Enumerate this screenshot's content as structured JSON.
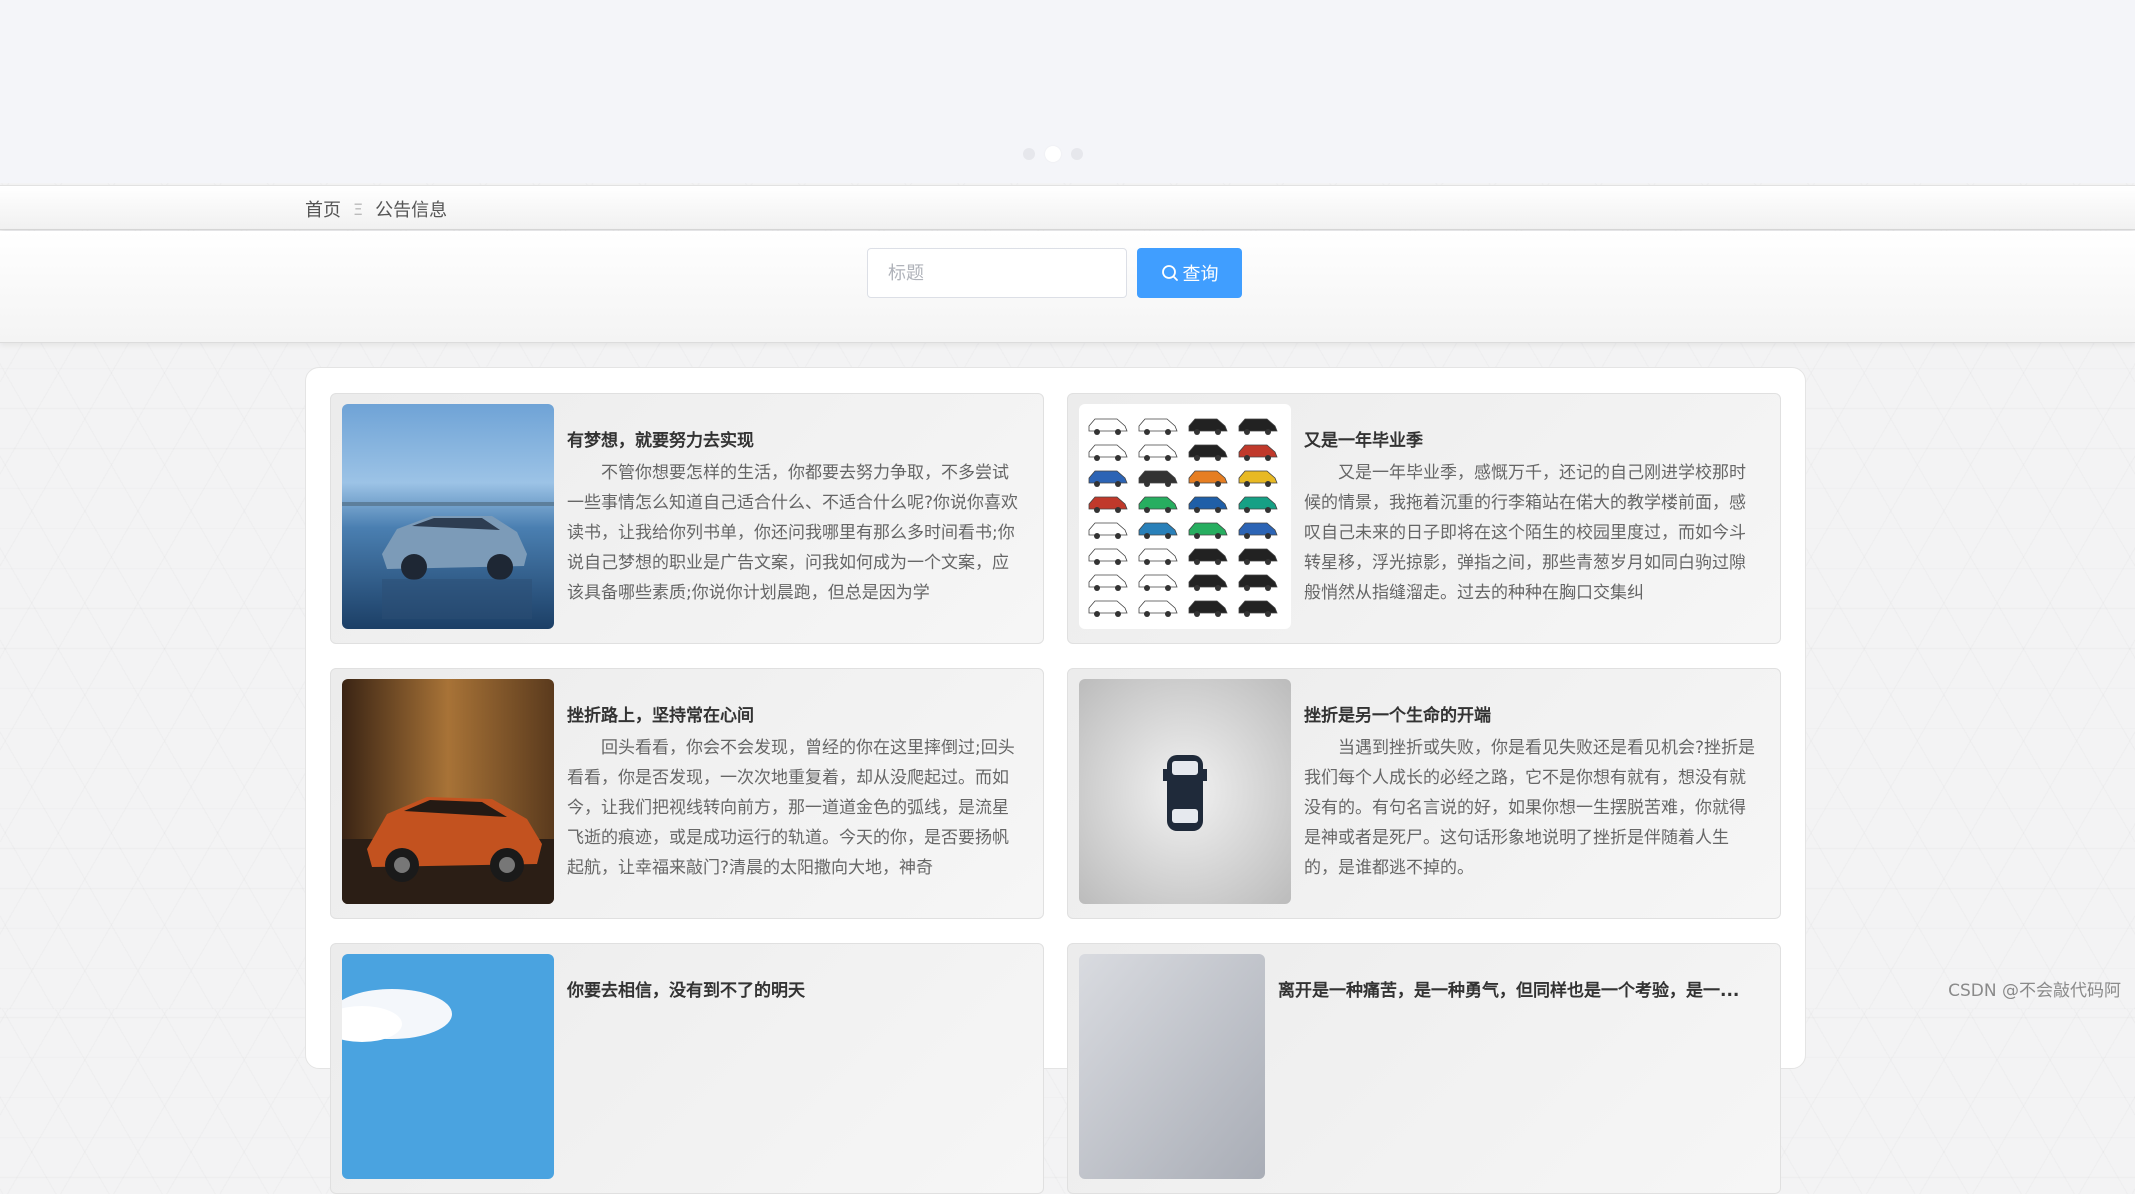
{
  "carousel": {
    "dots": 3,
    "active_index": 1
  },
  "breadcrumb": {
    "home": "首页",
    "separator": "Ξ",
    "current": "公告信息"
  },
  "search": {
    "placeholder": "标题",
    "value": "",
    "button_label": "查询"
  },
  "notices": [
    {
      "title": "有梦想，就要努力去实现",
      "body": "不管你想要怎样的生活，你都要去努力争取，不多尝试一些事情怎么知道自己适合什么、不适合什么呢?你说你喜欢读书，让我给你列书单，你还问我哪里有那么多时间看书;你说自己梦想的职业是广告文案，问我如何成为一个文案，应该具备哪些素质;你说你计划晨跑，但总是因为学",
      "image": "blue-suv-on-beach"
    },
    {
      "title": "又是一年毕业季",
      "body": "又是一年毕业季，感慨万千，还记的自己刚进学校那时候的情景，我拖着沉重的行李箱站在偌大的教学楼前面，感叹自己未来的日子即将在这个陌生的校园里度过，而如今斗转星移，浮光掠影，弹指之间，那些青葱岁月如同白驹过隙般悄然从指缝溜走。过去的种种在胸口交集纠",
      "image": "car-icon-grid"
    },
    {
      "title": "挫折路上，坚持常在心间",
      "body": "回头看看，你会不会发现，曾经的你在这里摔倒过;回头看看，你是否发现，一次次地重复着，却从没爬起过。而如今，让我们把视线转向前方，那一道道金色的弧线，是流星飞逝的痕迹，或是成功运行的轨道。今天的你，是否要扬帆起航，让幸福来敲门?清晨的太阳撒向大地，神奇",
      "image": "orange-suv-interior"
    },
    {
      "title": "挫折是另一个生命的开端",
      "body": "当遇到挫折或失败，你是看见失败还是看见机会?挫折是我们每个人成长的必经之路，它不是你想有就有，想没有就没有的。有句名言说的好，如果你想一生摆脱苦难，你就得是神或者是死尸。这句话形象地说明了挫折是伴随着人生的，是谁都逃不掉的。",
      "image": "car-top-view-icon"
    },
    {
      "title": "你要去相信，没有到不了的明天",
      "body": "",
      "image": "sky-clouds"
    },
    {
      "title": "离开是一种痛苦，是一种勇气，但同样也是一个考验，是一...",
      "body": "",
      "image": "grey-gradient"
    }
  ],
  "watermark": "CSDN @不会敲代码阿"
}
